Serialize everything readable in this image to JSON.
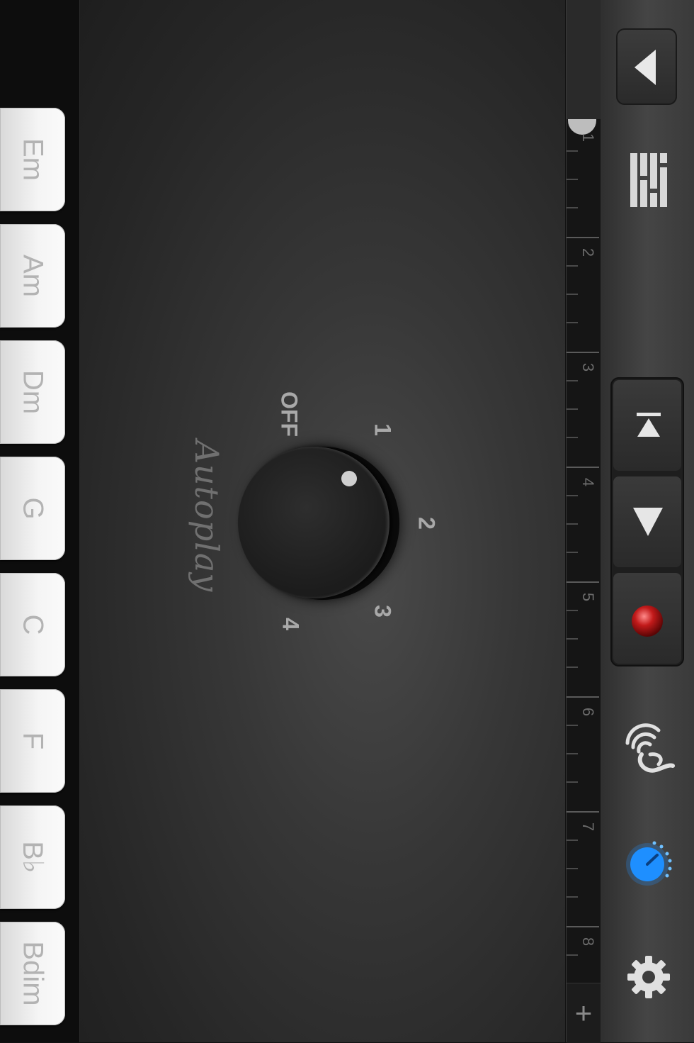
{
  "chords": [
    "Em",
    "Am",
    "Dm",
    "G",
    "C",
    "F",
    "B♭",
    "Bdim"
  ],
  "autoplay": {
    "label": "Autoplay",
    "marks": {
      "off": "OFF",
      "one": "1",
      "two": "2",
      "three": "3",
      "four": "4"
    }
  },
  "ruler": {
    "bars": [
      "1",
      "2",
      "3",
      "4",
      "5",
      "6",
      "7",
      "8"
    ],
    "add_label": "+"
  },
  "toolbar": {
    "icons": {
      "back": "triangle-left-icon",
      "tracks": "tracks-view-icon",
      "rewind": "go-to-beginning-icon",
      "play": "play-icon",
      "record": "record-icon",
      "smart_controls": "hand-strum-icon",
      "settings_knob": "blue-knob-icon",
      "settings": "gear-icon"
    },
    "colors": {
      "record": "#c21a1a",
      "active_knob": "#1e8fff"
    }
  }
}
